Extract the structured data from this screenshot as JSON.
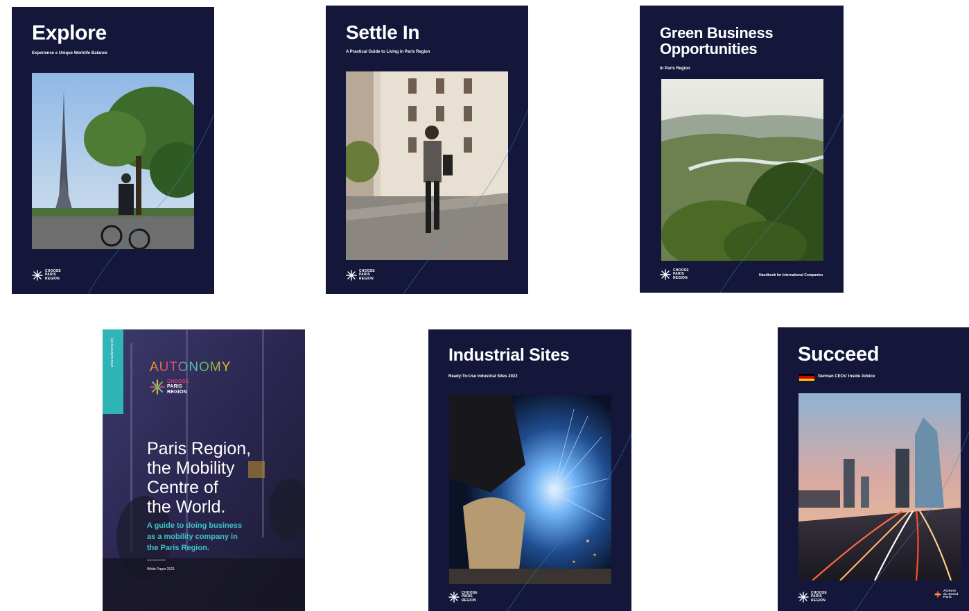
{
  "covers": [
    {
      "title": "Explore",
      "subtitle": "Experience a Unique Worklife Balance",
      "logo": {
        "line1": "CHOOSE",
        "line2": "PARIS",
        "line3": "REGION"
      }
    },
    {
      "title": "Settle In",
      "subtitle": "A Practical Guide to Living in Paris Region",
      "logo": {
        "line1": "CHOOSE",
        "line2": "PARIS",
        "line3": "REGION"
      }
    },
    {
      "title": "Green Business Opportunities",
      "subtitle": "In Paris Region",
      "note": "Handbook for International Companies",
      "logo": {
        "line1": "CHOOSE",
        "line2": "PARIS",
        "line3": "REGION"
      }
    },
    {
      "side_text": "www.autonomy.city",
      "brand": "AUTONOMY",
      "logo": {
        "line1": "CHOOSE",
        "line2": "PARIS",
        "line3": "REGION"
      },
      "headline_lines": [
        "Paris Region,",
        "the Mobility",
        "Centre of",
        "the World."
      ],
      "lead_lines": [
        "A guide to doing business",
        "as a mobility company in",
        "the Paris Region."
      ],
      "footer": "White Paper 2021"
    },
    {
      "title": "Industrial Sites",
      "subtitle": "Ready-To-Use Industrial Sites 2022",
      "logo": {
        "line1": "CHOOSE",
        "line2": "PARIS",
        "line3": "REGION"
      }
    },
    {
      "title": "Succeed",
      "subtitle": "German CEOs' Inside Advice",
      "logo": {
        "line1": "CHOOSE",
        "line2": "PARIS",
        "line3": "REGION"
      },
      "partner": {
        "line1": "Acteurs",
        "line2": "du Grand",
        "line3": "Paris"
      }
    }
  ],
  "colors": {
    "navy": "#14163a",
    "teal": "#2fb5b5",
    "accent_line": "#2e8ecf"
  }
}
